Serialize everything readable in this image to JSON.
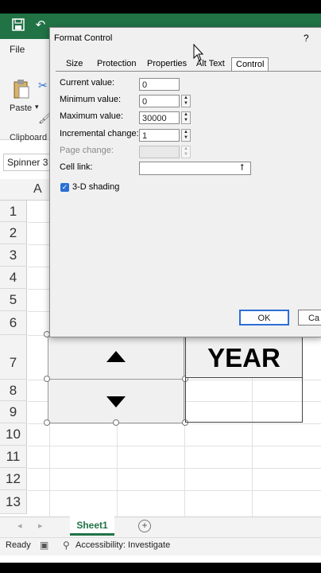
{
  "app": {
    "file_tab": "File",
    "name_box": "Spinner 3",
    "paste_label": "Paste",
    "clipboard_group": "Clipboard"
  },
  "columns": [
    "A"
  ],
  "rows": [
    "1",
    "2",
    "3",
    "4",
    "5",
    "6",
    "7",
    "8",
    "9",
    "10",
    "11",
    "12",
    "13"
  ],
  "sheet": {
    "tab": "Sheet1"
  },
  "cells": {
    "year_header": "YEAR"
  },
  "status": {
    "ready": "Ready",
    "accessibility": "Accessibility: Investigate"
  },
  "dialog": {
    "title": "Format Control",
    "help": "?",
    "tabs": [
      "Size",
      "Protection",
      "Properties",
      "Alt Text",
      "Control"
    ],
    "active_tab": "Control",
    "fields": {
      "current_value": {
        "label": "Current value:",
        "value": "0"
      },
      "minimum_value": {
        "label": "Minimum value:",
        "value": "0"
      },
      "maximum_value": {
        "label": "Maximum value:",
        "value": "30000"
      },
      "incremental_change": {
        "label": "Incremental change:",
        "value": "1"
      },
      "page_change": {
        "label": "Page change:",
        "value": ""
      },
      "cell_link": {
        "label": "Cell link:",
        "value": ""
      }
    },
    "shading": {
      "label": "3-D shading",
      "checked": true
    },
    "ok": "OK",
    "cancel": "Ca"
  },
  "colors": {
    "excel_green": "#217346",
    "dialog_bg": "#f0f0f0",
    "accent_blue": "#2b6fd6"
  }
}
